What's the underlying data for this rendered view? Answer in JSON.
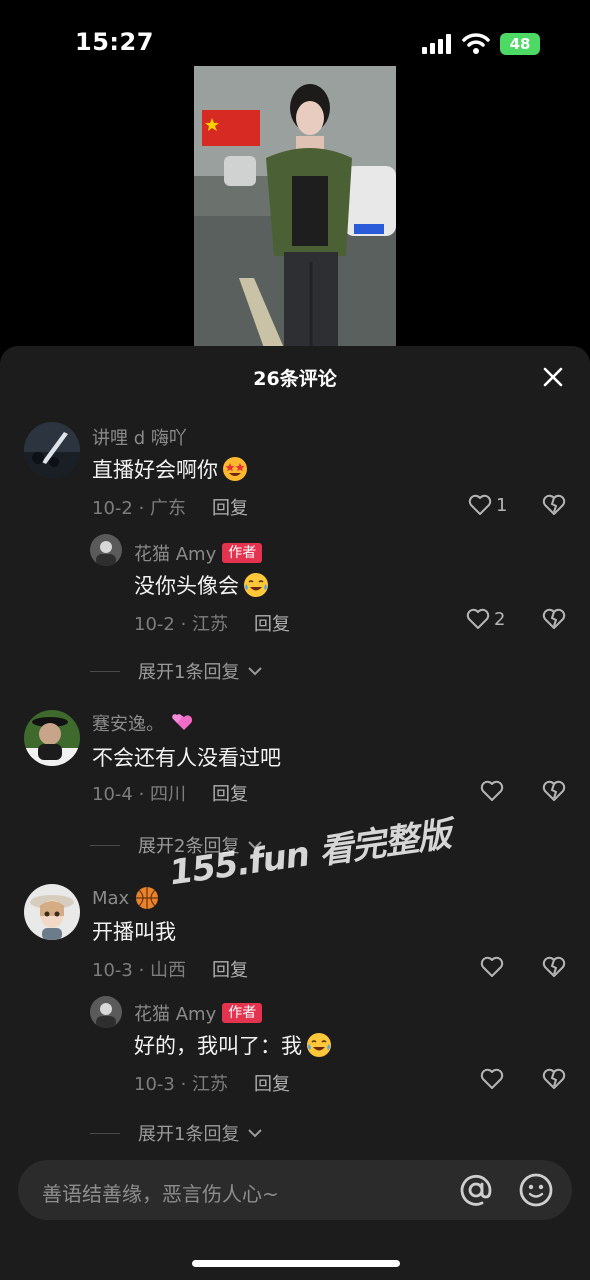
{
  "status_bar": {
    "time": "15:27",
    "battery": "48"
  },
  "sheet": {
    "title": "26条评论"
  },
  "comments": [
    {
      "user": "讲哩 d 嗨吖",
      "text": "直播好会啊你",
      "date_loc": "10-2 · 广东",
      "reply_label": "回复",
      "likes": "1"
    },
    {
      "user": "花猫 Amy",
      "author_tag": "作者",
      "text": "没你头像会",
      "date_loc": "10-2 · 江苏",
      "reply_label": "回复",
      "likes": "2",
      "expand": "展开1条回复"
    },
    {
      "user": "蹇安逸。",
      "text": "不会还有人没看过吧",
      "date_loc": "10-4 · 四川",
      "reply_label": "回复",
      "likes": "",
      "expand": "展开2条回复"
    },
    {
      "user": "Max",
      "text": "开播叫我",
      "date_loc": "10-3 · 山西",
      "reply_label": "回复",
      "likes": ""
    },
    {
      "user": "花猫 Amy",
      "author_tag": "作者",
      "text": "好的，我叫了：我",
      "date_loc": "10-3 · 江苏",
      "reply_label": "回复",
      "likes": "",
      "expand": "展开1条回复"
    }
  ],
  "watermark": "155.fun 看完整版",
  "input": {
    "placeholder": "善语结善缘，恶言伤人心~"
  }
}
